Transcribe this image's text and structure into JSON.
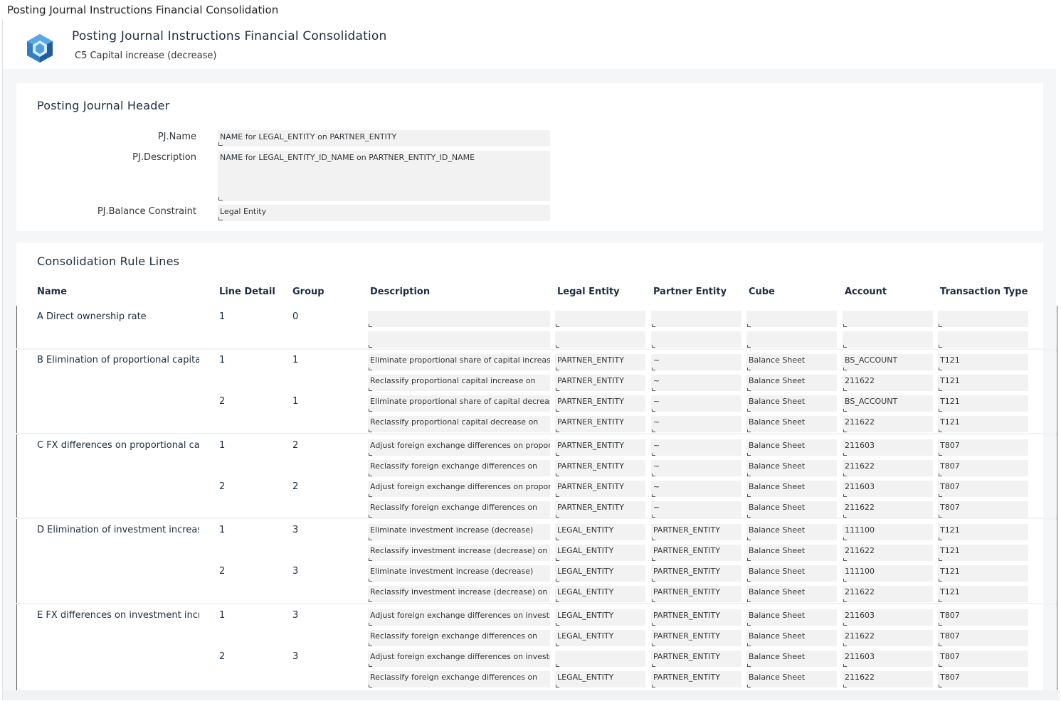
{
  "window_title": "Posting Journal Instructions Financial Consolidation",
  "app": {
    "title": "Posting Journal Instructions Financial Consolidation",
    "subtitle": "C5 Capital increase (decrease)",
    "logo_icon": "hexagon-cube-icon"
  },
  "header_section": {
    "title": "Posting Journal Header",
    "fields": [
      {
        "label": "PJ.Name",
        "value": "NAME for LEGAL_ENTITY on PARTNER_ENTITY"
      },
      {
        "label": "PJ.Description",
        "value": "NAME for LEGAL_ENTITY_ID_NAME on PARTNER_ENTITY_ID_NAME"
      },
      {
        "label": "PJ.Balance Constraint",
        "value": "Legal Entity"
      }
    ]
  },
  "rules_section": {
    "title": "Consolidation Rule Lines",
    "columns": [
      "Name",
      "Line Detail",
      "Group",
      "Description",
      "Legal Entity",
      "Partner Entity",
      "Cube",
      "Account",
      "Transaction Type"
    ],
    "groups": [
      {
        "name": "A Direct ownership rate",
        "lines": [
          {
            "line_detail": "1",
            "group": "0",
            "rows": [
              {
                "description": "",
                "legal_entity": "",
                "partner_entity": "",
                "cube": "",
                "account": "",
                "transaction_type": ""
              },
              {
                "description": "",
                "legal_entity": "",
                "partner_entity": "",
                "cube": "",
                "account": "",
                "transaction_type": ""
              }
            ]
          }
        ]
      },
      {
        "name": "B Elimination of proportional capital increase (decrease)",
        "lines": [
          {
            "line_detail": "1",
            "group": "1",
            "rows": [
              {
                "description": "Eliminate proportional share of capital increase",
                "legal_entity": "PARTNER_ENTITY",
                "partner_entity": "~",
                "cube": "Balance Sheet",
                "account": "BS_ACCOUNT",
                "transaction_type": "T121"
              },
              {
                "description": "Reclassify proportional capital increase on",
                "legal_entity": "PARTNER_ENTITY",
                "partner_entity": "~",
                "cube": "Balance Sheet",
                "account": "211622",
                "transaction_type": "T121"
              }
            ]
          },
          {
            "line_detail": "2",
            "group": "1",
            "rows": [
              {
                "description": "Eliminate proportional share of capital decrease",
                "legal_entity": "PARTNER_ENTITY",
                "partner_entity": "~",
                "cube": "Balance Sheet",
                "account": "BS_ACCOUNT",
                "transaction_type": "T121"
              },
              {
                "description": "Reclassify proportional capital decrease on",
                "legal_entity": "PARTNER_ENTITY",
                "partner_entity": "~",
                "cube": "Balance Sheet",
                "account": "211622",
                "transaction_type": "T121"
              }
            ]
          }
        ]
      },
      {
        "name": "C FX differences on proportional capital",
        "lines": [
          {
            "line_detail": "1",
            "group": "2",
            "rows": [
              {
                "description": "Adjust foreign exchange differences on proportional",
                "legal_entity": "PARTNER_ENTITY",
                "partner_entity": "~",
                "cube": "Balance Sheet",
                "account": "211603",
                "transaction_type": "T807"
              },
              {
                "description": "Reclassify foreign exchange differences on",
                "legal_entity": "PARTNER_ENTITY",
                "partner_entity": "~",
                "cube": "Balance Sheet",
                "account": "211622",
                "transaction_type": "T807"
              }
            ]
          },
          {
            "line_detail": "2",
            "group": "2",
            "rows": [
              {
                "description": "Adjust foreign exchange differences on proportional",
                "legal_entity": "PARTNER_ENTITY",
                "partner_entity": "~",
                "cube": "Balance Sheet",
                "account": "211603",
                "transaction_type": "T807"
              },
              {
                "description": "Reclassify foreign exchange differences on",
                "legal_entity": "PARTNER_ENTITY",
                "partner_entity": "~",
                "cube": "Balance Sheet",
                "account": "211622",
                "transaction_type": "T807"
              }
            ]
          }
        ]
      },
      {
        "name": "D Elimination of investment increase (decrease)",
        "lines": [
          {
            "line_detail": "1",
            "group": "3",
            "rows": [
              {
                "description": "Eliminate investment increase (decrease)",
                "legal_entity": "LEGAL_ENTITY",
                "partner_entity": "PARTNER_ENTITY",
                "cube": "Balance Sheet",
                "account": "111100",
                "transaction_type": "T121"
              },
              {
                "description": "Reclassify investment increase (decrease) on",
                "legal_entity": "LEGAL_ENTITY",
                "partner_entity": "PARTNER_ENTITY",
                "cube": "Balance Sheet",
                "account": "211622",
                "transaction_type": "T121"
              }
            ]
          },
          {
            "line_detail": "2",
            "group": "3",
            "rows": [
              {
                "description": "Eliminate investment increase (decrease)",
                "legal_entity": "LEGAL_ENTITY",
                "partner_entity": "PARTNER_ENTITY",
                "cube": "Balance Sheet",
                "account": "111100",
                "transaction_type": "T121"
              },
              {
                "description": "Reclassify investment increase (decrease) on",
                "legal_entity": "LEGAL_ENTITY",
                "partner_entity": "PARTNER_ENTITY",
                "cube": "Balance Sheet",
                "account": "211622",
                "transaction_type": "T121"
              }
            ]
          }
        ]
      },
      {
        "name": "E FX differences on investment increase",
        "lines": [
          {
            "line_detail": "1",
            "group": "3",
            "rows": [
              {
                "description": "Adjust foreign exchange differences on investment",
                "legal_entity": "LEGAL_ENTITY",
                "partner_entity": "PARTNER_ENTITY",
                "cube": "Balance Sheet",
                "account": "211603",
                "transaction_type": "T807"
              },
              {
                "description": "Reclassify foreign exchange differences on",
                "legal_entity": "LEGAL_ENTITY",
                "partner_entity": "PARTNER_ENTITY",
                "cube": "Balance Sheet",
                "account": "211622",
                "transaction_type": "T807"
              }
            ]
          },
          {
            "line_detail": "2",
            "group": "3",
            "rows": [
              {
                "description": "Adjust foreign exchange differences on investment",
                "legal_entity": "",
                "partner_entity": "PARTNER_ENTITY",
                "cube": "Balance Sheet",
                "account": "211603",
                "transaction_type": "T807"
              },
              {
                "description": "Reclassify foreign exchange differences on",
                "legal_entity": "LEGAL_ENTITY",
                "partner_entity": "PARTNER_ENTITY",
                "cube": "Balance Sheet",
                "account": "211622",
                "transaction_type": "T807"
              }
            ]
          }
        ]
      }
    ]
  }
}
